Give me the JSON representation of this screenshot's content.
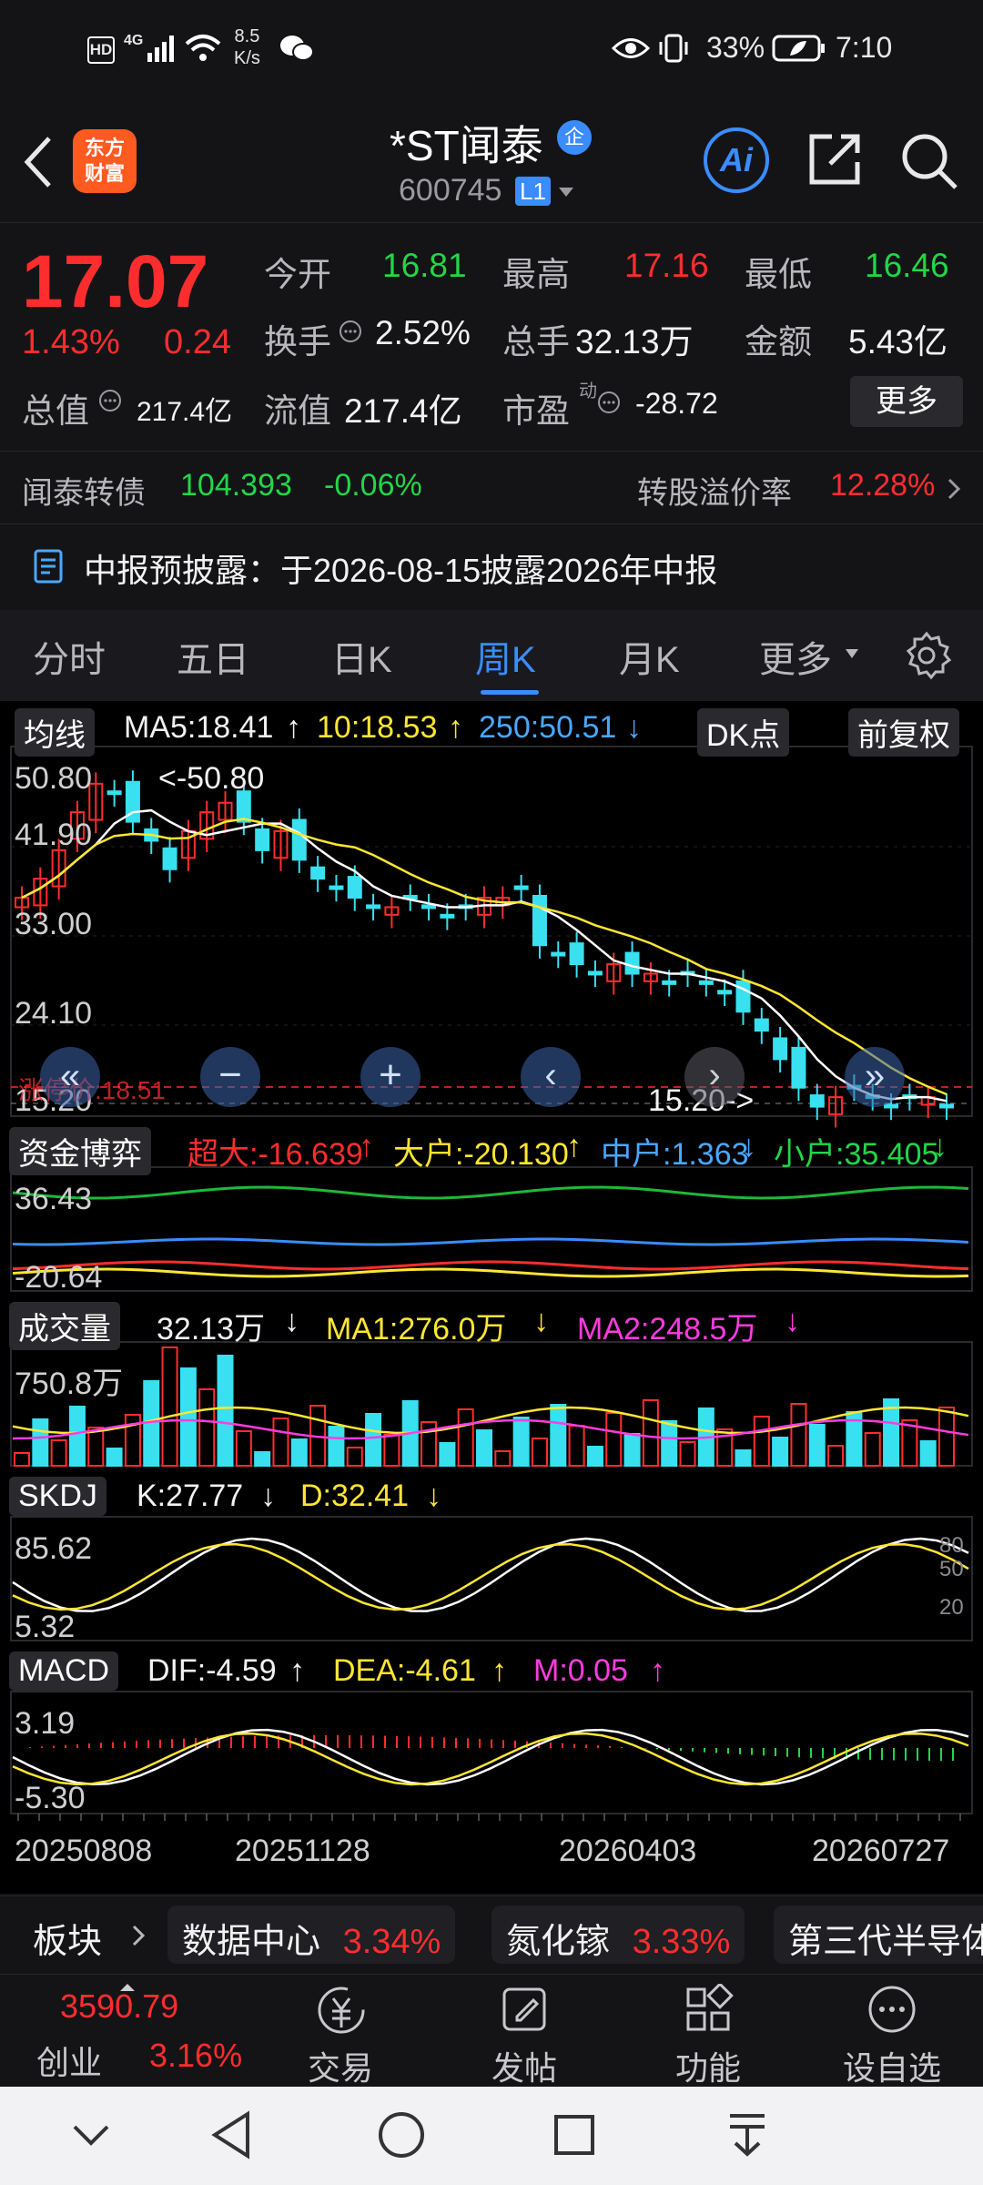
{
  "status_bar": {
    "net_speed_value": "8.5",
    "net_speed_unit": "K/s",
    "battery": "33%",
    "time": "7:10",
    "hd_label": "HD",
    "network_label": "4G"
  },
  "header": {
    "brand_logo_line1": "东方",
    "brand_logo_line2": "财富",
    "stock_name": "*ST闻泰",
    "enterprise_badge": "企",
    "stock_code": "600745",
    "level_badge": "L1",
    "ai_label": "Ai"
  },
  "quote": {
    "price": "17.07",
    "change_pct": "1.43%",
    "change_abs": "0.24",
    "open_label": "今开",
    "open_value": "16.81",
    "high_label": "最高",
    "high_value": "17.16",
    "low_label": "最低",
    "low_value": "16.46",
    "turnover_label": "换手",
    "turnover_value": "2.52%",
    "volume_label": "总手",
    "volume_value": "32.13万",
    "amount_label": "金额",
    "amount_value": "5.43亿",
    "total_mv_label": "总值",
    "total_mv_value": "217.4亿",
    "float_mv_label": "流值",
    "float_mv_value": "217.4亿",
    "pe_label": "市盈",
    "pe_sup": "动",
    "pe_value": "-28.72",
    "more_button": "更多"
  },
  "bond": {
    "name": "闻泰转债",
    "price": "104.393",
    "change": "-0.06%",
    "premium_label": "转股溢价率",
    "premium_value": "12.28%"
  },
  "notice": {
    "text": "中报预披露：于2026-08-15披露2026年中报"
  },
  "tabs": [
    "分时",
    "五日",
    "日K",
    "周K",
    "月K",
    "更多"
  ],
  "active_tab": "周K",
  "indicators": {
    "ma_selector": "均线",
    "ma5": "MA5:18.41",
    "ma10": "10:18.53",
    "ma250": "250:50.51",
    "dk_button": "DK点",
    "adjust_button": "前复权",
    "price_axis": [
      "50.80",
      "41.90",
      "33.00",
      "24.10",
      "15.20"
    ],
    "high_marker": "<-50.80",
    "low_marker": "15.20->",
    "limit_up": "涨停价:18.51",
    "fund_selector": "资金博弈",
    "super_large": "超大:-16.639",
    "large": "大户:-20.130",
    "medium": "中户:1.363",
    "small": "小户:35.405",
    "fund_axis": [
      "36.43",
      "-20.64"
    ],
    "vol_selector": "成交量",
    "vol_value": "32.13万",
    "vol_ma1": "MA1:276.0万",
    "vol_ma2": "MA2:248.5万",
    "vol_axis": "750.8万",
    "skdj_selector": "SKDJ",
    "skdj_k": "K:27.77",
    "skdj_d": "D:32.41",
    "skdj_axis": [
      "85.62",
      "5.32"
    ],
    "skdj_levels": [
      "80",
      "50",
      "20"
    ],
    "macd_selector": "MACD",
    "macd_dif": "DIF:-4.59",
    "macd_dea": "DEA:-4.61",
    "macd_m": "M:0.05",
    "macd_axis": [
      "3.19",
      "-5.30"
    ],
    "dates": [
      "20250808",
      "20251128",
      "20260403",
      "20260727"
    ]
  },
  "sector_bar": {
    "label": "板块",
    "items": [
      {
        "name": "数据中心",
        "pct": "3.34%"
      },
      {
        "name": "氮化镓",
        "pct": "3.33%"
      },
      {
        "name": "第三代半导体",
        "pct": ""
      }
    ]
  },
  "bottom_bar": {
    "index_value": "3590.79",
    "index_name": "创业",
    "index_pct": "3.16%",
    "items": [
      "交易",
      "发帖",
      "功能",
      "设自选"
    ]
  },
  "colors": {
    "up": "#ff2d2d",
    "down": "#22d648",
    "candle_down": "#38e0f0",
    "accent": "#3a8cff",
    "ma5": "#ffffff",
    "ma10": "#ffe632",
    "magenta": "#ff3be0"
  }
}
